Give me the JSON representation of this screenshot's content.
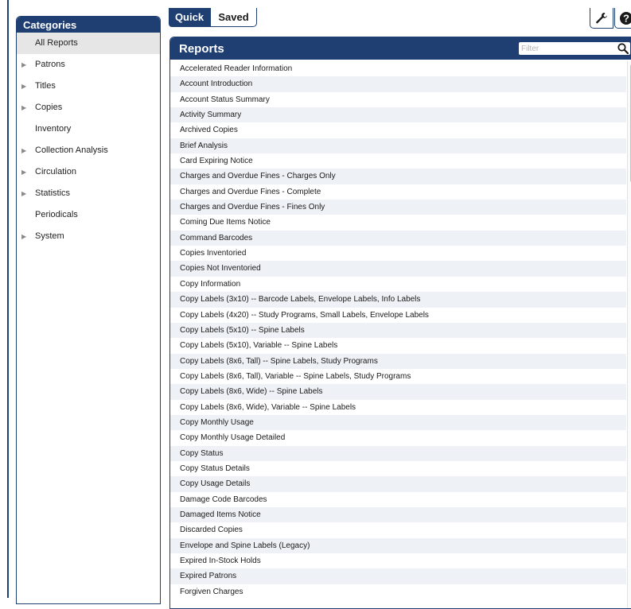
{
  "tabs": {
    "quick": "Quick",
    "saved": "Saved"
  },
  "toolbar": {
    "settings_icon": "wrench-icon",
    "help_icon": "help-icon"
  },
  "categories": {
    "title": "Categories",
    "items": [
      {
        "label": "All Reports",
        "expandable": false,
        "selected": true
      },
      {
        "label": "Patrons",
        "expandable": true
      },
      {
        "label": "Titles",
        "expandable": true
      },
      {
        "label": "Copies",
        "expandable": true
      },
      {
        "label": "Inventory",
        "expandable": false
      },
      {
        "label": "Collection Analysis",
        "expandable": true
      },
      {
        "label": "Circulation",
        "expandable": true
      },
      {
        "label": "Statistics",
        "expandable": true
      },
      {
        "label": "Periodicals",
        "expandable": false
      },
      {
        "label": "System",
        "expandable": true
      }
    ]
  },
  "reports": {
    "title": "Reports",
    "filter_placeholder": "Filter",
    "filter_icon": "search-icon",
    "items": [
      "Accelerated Reader Information",
      "Account Introduction",
      "Account Status Summary",
      "Activity Summary",
      "Archived Copies",
      "Brief Analysis",
      "Card Expiring Notice",
      "Charges and Overdue Fines - Charges Only",
      "Charges and Overdue Fines - Complete",
      "Charges and Overdue Fines - Fines Only",
      "Coming Due Items Notice",
      "Command Barcodes",
      "Copies Inventoried",
      "Copies Not Inventoried",
      "Copy Information",
      "Copy Labels (3x10) -- Barcode Labels, Envelope Labels, Info Labels",
      "Copy Labels (4x20) -- Study Programs, Small Labels, Envelope Labels",
      "Copy Labels (5x10) -- Spine Labels",
      "Copy Labels (5x10), Variable -- Spine Labels",
      "Copy Labels (8x6, Tall) -- Spine Labels, Study Programs",
      "Copy Labels (8x6, Tall), Variable -- Spine Labels, Study Programs",
      "Copy Labels (8x6, Wide) -- Spine Labels",
      "Copy Labels (8x6, Wide), Variable -- Spine Labels",
      "Copy Monthly Usage",
      "Copy Monthly Usage Detailed",
      "Copy Status",
      "Copy Status Details",
      "Copy Usage Details",
      "Damage Code Barcodes",
      "Damaged Items Notice",
      "Discarded Copies",
      "Envelope and Spine Labels (Legacy)",
      "Expired In-Stock Holds",
      "Expired Patrons",
      "Forgiven Charges"
    ]
  },
  "colors": {
    "header": "#1f3f73",
    "selected_row": "#e6e6e6",
    "alt_row": "#eef1f5"
  }
}
